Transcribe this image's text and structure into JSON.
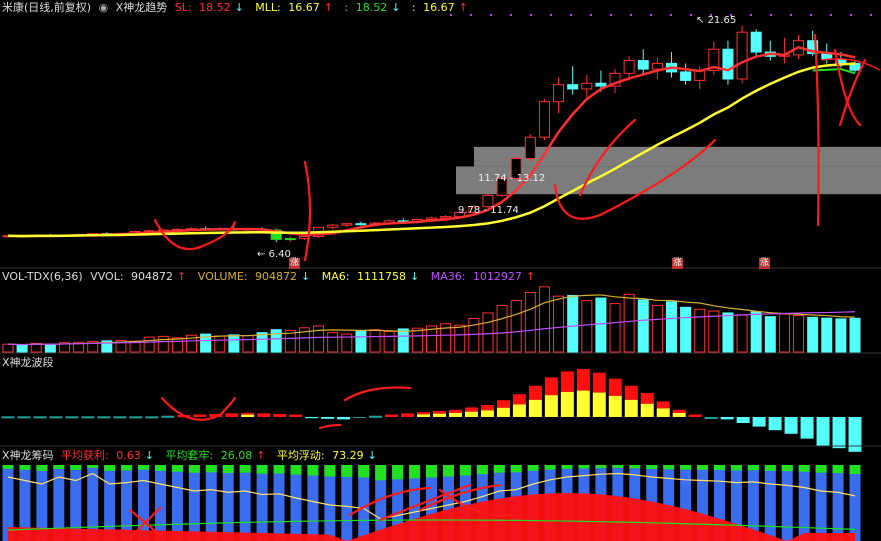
{
  "price_legend": {
    "symbol": "米康(日线,前复权)",
    "indicator_name": "X神龙趋势",
    "sl_label": "SL:",
    "sl_value": "18.52",
    "sl_arrow": "↓",
    "mll_label": "MLL:",
    "mll_value": "16.67",
    "mll_arrow": "↑",
    "v3_label": ":",
    "v3_value": "18.52",
    "v3_arrow": "↓",
    "v4_label": ":",
    "v4_value": "16.67",
    "v4_arrow": "↑"
  },
  "price_annotations": {
    "high_label": "21.65",
    "low_label": "6.40",
    "zone_upper": "11.74 - 13.12",
    "zone_lower": "9.78 - 11.74",
    "marker_1": "涨",
    "marker_2": "涨",
    "marker_3": "涨"
  },
  "vol_legend": {
    "name": "VOL-TDX(6,36)",
    "vvol_label": "VVOL:",
    "vvol_value": "904872",
    "vvol_arrow": "↑",
    "volume_label": "VOLUME:",
    "volume_value": "904872",
    "volume_arrow": "↓",
    "ma6_label": "MA6:",
    "ma6_value": "1111758",
    "ma6_arrow": "↓",
    "ma36_label": "MA36:",
    "ma36_value": "1012927",
    "ma36_arrow": "↑"
  },
  "wave_legend": {
    "name": "X神龙波段"
  },
  "chip_legend": {
    "name": "X神龙筹码",
    "profit_label": "平均获利:",
    "profit_value": "0.63",
    "profit_arrow": "↓",
    "trapped_label": "平均套牢:",
    "trapped_value": "26.08",
    "trapped_arrow": "↑",
    "float_label": "平均浮动:",
    "float_value": "73.29",
    "float_arrow": "↓"
  },
  "colors": {
    "up": "#ff3030",
    "down": "#54ffff",
    "yellow": "#ffff30",
    "purple": "#c050ff",
    "ma_gold": "#d8b030",
    "chip_blue": "#3a6cf0",
    "chip_green": "#20e020",
    "chip_red": "#ff1010",
    "zone_grey": "#8a8a8a"
  },
  "chart_data": {
    "type": "candlestick",
    "candles": [
      [
        6.8,
        6.9,
        6.7,
        6.85
      ],
      [
        6.85,
        6.95,
        6.75,
        6.8
      ],
      [
        6.8,
        6.9,
        6.7,
        6.88
      ],
      [
        6.88,
        6.98,
        6.8,
        6.85
      ],
      [
        6.85,
        6.95,
        6.78,
        6.9
      ],
      [
        6.9,
        7.0,
        6.82,
        6.92
      ],
      [
        6.92,
        7.05,
        6.85,
        7.0
      ],
      [
        7.0,
        7.1,
        6.9,
        6.95
      ],
      [
        6.95,
        7.05,
        6.88,
        7.02
      ],
      [
        7.02,
        7.2,
        6.95,
        7.15
      ],
      [
        7.15,
        7.3,
        7.05,
        7.2
      ],
      [
        7.2,
        7.35,
        7.1,
        7.25
      ],
      [
        7.25,
        7.4,
        7.15,
        7.3
      ],
      [
        7.3,
        7.45,
        7.2,
        7.35
      ],
      [
        7.35,
        7.5,
        7.25,
        7.3
      ],
      [
        7.3,
        7.45,
        7.2,
        7.35
      ],
      [
        7.35,
        7.5,
        7.2,
        7.28
      ],
      [
        7.28,
        7.4,
        7.15,
        7.32
      ],
      [
        7.32,
        7.45,
        7.2,
        7.25
      ],
      [
        7.25,
        7.35,
        6.4,
        6.6
      ],
      [
        6.6,
        6.8,
        6.45,
        6.65
      ],
      [
        6.65,
        6.9,
        6.55,
        6.8
      ],
      [
        6.8,
        7.5,
        6.7,
        7.45
      ],
      [
        7.45,
        7.7,
        7.3,
        7.6
      ],
      [
        7.6,
        7.75,
        7.45,
        7.7
      ],
      [
        7.7,
        7.85,
        7.55,
        7.65
      ],
      [
        7.65,
        7.8,
        7.5,
        7.75
      ],
      [
        7.75,
        8.0,
        7.6,
        7.9
      ],
      [
        7.9,
        8.1,
        7.75,
        7.85
      ],
      [
        7.85,
        8.05,
        7.7,
        8.0
      ],
      [
        8.0,
        8.2,
        7.85,
        8.1
      ],
      [
        8.1,
        8.3,
        7.95,
        8.2
      ],
      [
        8.2,
        8.6,
        8.1,
        8.5
      ],
      [
        8.5,
        9.0,
        8.4,
        8.9
      ],
      [
        8.9,
        9.8,
        8.8,
        9.7
      ],
      [
        9.7,
        11.0,
        9.6,
        10.9
      ],
      [
        10.9,
        12.5,
        10.7,
        12.3
      ],
      [
        12.3,
        14.0,
        12.1,
        13.8
      ],
      [
        13.8,
        16.5,
        13.6,
        16.3
      ],
      [
        16.3,
        18.0,
        15.5,
        17.5
      ],
      [
        17.5,
        18.8,
        16.8,
        17.2
      ],
      [
        17.2,
        18.2,
        16.6,
        17.6
      ],
      [
        17.6,
        18.5,
        17.0,
        17.4
      ],
      [
        17.4,
        18.6,
        16.9,
        18.3
      ],
      [
        18.3,
        19.5,
        17.8,
        19.2
      ],
      [
        19.2,
        20.0,
        18.2,
        18.6
      ],
      [
        18.6,
        19.4,
        17.9,
        19.0
      ],
      [
        19.0,
        19.8,
        18.0,
        18.4
      ],
      [
        18.4,
        19.0,
        17.5,
        17.8
      ],
      [
        17.8,
        18.8,
        17.2,
        18.5
      ],
      [
        18.5,
        20.5,
        18.2,
        20.0
      ],
      [
        20.0,
        20.6,
        17.5,
        17.9
      ],
      [
        17.9,
        21.65,
        17.6,
        21.2
      ],
      [
        21.2,
        21.4,
        19.5,
        19.8
      ],
      [
        19.8,
        20.6,
        19.2,
        19.5
      ],
      [
        19.5,
        20.8,
        19.0,
        19.6
      ],
      [
        19.6,
        21.0,
        19.3,
        20.6
      ],
      [
        20.6,
        21.3,
        19.5,
        19.7
      ],
      [
        19.7,
        20.4,
        19.0,
        19.3
      ],
      [
        19.3,
        19.8,
        18.7,
        19.0
      ],
      [
        19.0,
        19.2,
        18.4,
        18.52
      ]
    ],
    "volume": [
      210000,
      190000,
      230000,
      200000,
      250000,
      260000,
      280000,
      300000,
      310000,
      290000,
      400000,
      420000,
      380000,
      450000,
      480000,
      430000,
      460000,
      440000,
      520000,
      600000,
      580000,
      650000,
      700000,
      520000,
      480000,
      560000,
      600000,
      550000,
      620000,
      640000,
      700000,
      760000,
      720000,
      900000,
      1050000,
      1250000,
      1380000,
      1600000,
      1750000,
      1500000,
      1520000,
      1380000,
      1450000,
      1300000,
      1550000,
      1400000,
      1250000,
      1350000,
      1200000,
      1150000,
      1100000,
      1050000,
      1000000,
      1080000,
      950000,
      1020000,
      980000,
      930000,
      910000,
      890000,
      904872
    ],
    "wave": [
      0.05,
      0.05,
      0.05,
      0.05,
      0.05,
      0.05,
      0.05,
      0.05,
      0.05,
      0.05,
      0.1,
      0.15,
      0.2,
      0.25,
      0.3,
      0.35,
      0.3,
      0.25,
      0.2,
      -0.1,
      -0.15,
      -0.2,
      -0.05,
      0.1,
      0.2,
      0.3,
      0.4,
      0.5,
      0.6,
      0.8,
      1.0,
      1.4,
      1.9,
      2.6,
      3.3,
      3.8,
      4.0,
      3.7,
      3.2,
      2.6,
      2.0,
      1.3,
      0.6,
      0.2,
      0.0,
      -0.2,
      -0.5,
      -0.8,
      -1.1,
      -1.4,
      -1.8,
      -2.4,
      -2.6,
      -2.9
    ],
    "chip_profit": [
      0.9,
      0.85,
      0.8,
      0.9,
      0.85,
      0.95,
      0.8,
      0.82,
      0.85,
      0.8,
      0.75,
      0.7,
      0.72,
      0.68,
      0.7,
      0.65,
      0.66,
      0.6,
      0.55,
      0.5,
      0.48,
      0.45,
      0.3,
      0.35,
      0.4,
      0.45,
      0.5,
      0.55,
      0.62,
      0.7,
      0.72,
      0.8,
      0.86,
      0.9,
      0.92,
      0.94,
      0.95,
      0.93,
      0.9,
      0.88,
      0.86,
      0.85,
      0.84,
      0.82,
      0.83,
      0.8,
      0.78,
      0.75,
      0.7,
      0.68,
      0.63
    ]
  }
}
